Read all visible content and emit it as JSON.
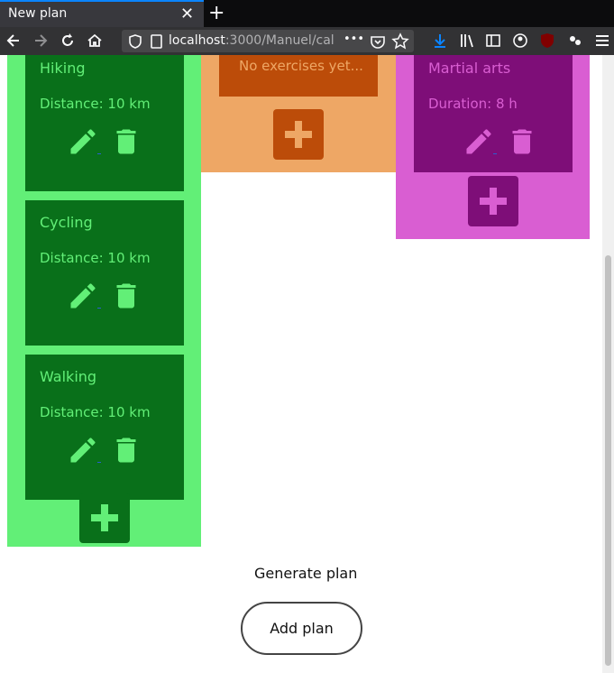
{
  "browser": {
    "tab_title": "New plan",
    "tab_close": "✕",
    "new_tab": "+",
    "url_host": "localhost",
    "url_rest": ":3000/Manuel/cal",
    "url_more": "•••"
  },
  "columns": {
    "green": {
      "accent": "#62ef77",
      "card_bg": "#09701a",
      "cards": [
        {
          "name": "Hiking",
          "meta": "Distance: 10 km"
        },
        {
          "name": "Cycling",
          "meta": "Distance: 10 km"
        },
        {
          "name": "Walking",
          "meta": "Distance: 10 km"
        }
      ]
    },
    "orange": {
      "accent": "#eea765",
      "box_bg": "#bc4c09",
      "empty_text": "No exercises yet..."
    },
    "pink": {
      "accent": "#d95ed2",
      "card_bg": "#7e0e78",
      "cards": [
        {
          "name": "Martial arts",
          "meta": "Duration: 8 h"
        }
      ]
    }
  },
  "footer": {
    "generate_label": "Generate plan",
    "add_plan_label": "Add plan"
  }
}
